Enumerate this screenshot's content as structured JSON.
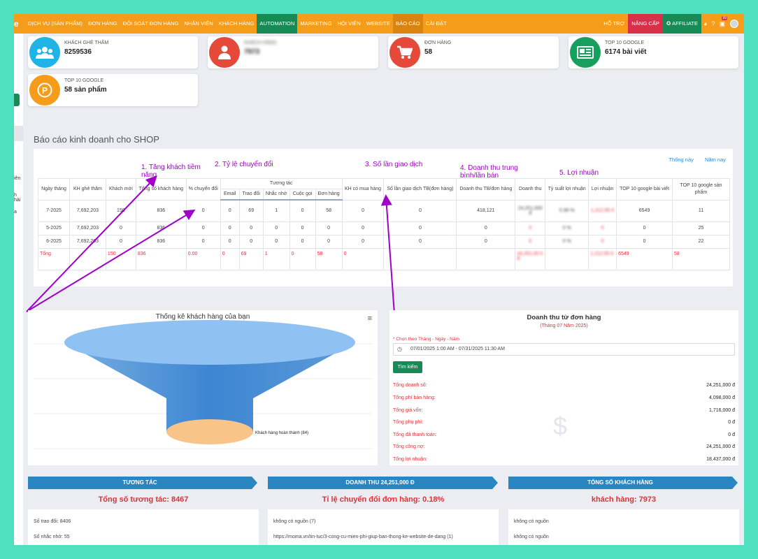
{
  "brand": "e",
  "nav": {
    "items": [
      "DỊCH VỤ (SẢN PHẨM)",
      "ĐƠN HÀNG",
      "ĐỐI SOÁT ĐƠN HÀNG",
      "NHÂN VIÊN",
      "KHÁCH HÀNG",
      "AUTOMATION",
      "MARKETING",
      "HỘI VIÊN",
      "WEBSITE",
      "BÁO CÁO",
      "CÀI ĐẶT"
    ],
    "support": "HỖ TRỢ",
    "upgrade": "NÂNG CẤP",
    "affiliate": "AFFILIATE",
    "notif_count": "99"
  },
  "sidebar": {
    "fragments": [
      "iên",
      "h hài",
      "a"
    ]
  },
  "stats": [
    {
      "label": "KHÁCH GHÉ THĂM",
      "value": "8259536",
      "color": "#1fb3e6",
      "icon": "users-icon"
    },
    {
      "label": "KHÁCH HÀNG",
      "value": "7973",
      "color": "#e5493a",
      "icon": "user-icon"
    },
    {
      "label": "ĐƠN HÀNG",
      "value": "58",
      "color": "#e5493a",
      "icon": "cart-icon"
    },
    {
      "label": "TOP 10 GOOGLE",
      "value": "6174 bài viết",
      "color": "#17a05d",
      "icon": "newspaper-icon"
    },
    {
      "label": "TOP 10 GOOGLE",
      "value": "58 sản phẩm",
      "color": "#f59c1a",
      "icon": "product-p-icon"
    }
  ],
  "report": {
    "title": "Báo cáo kinh doanh cho SHOP",
    "link_today": "Thống này",
    "link_year": "Năm nay",
    "group_header": "Tương tác",
    "headers": [
      "Ngày tháng",
      "KH ghé thăm",
      "Khách mới",
      "Tổng số khách hàng",
      "% chuyển đổi",
      "Email",
      "Trao đổi",
      "Nhắc nhở",
      "Cuộc gọi",
      "Đơn hàng",
      "KH có mua hàng",
      "Số lần giao dịch TB(đơn hàng)",
      "Doanh thu TB/đơn hàng",
      "Doanh thu",
      "Tỷ suất lợi nhuận",
      "Lợi nhuận",
      "TOP 10 google bài viết",
      "TOP 10 google sản phẩm"
    ],
    "rows": [
      [
        "7-2025",
        "7,692,203",
        "150",
        "836",
        "0",
        "0",
        "69",
        "1",
        "0",
        "58",
        "0",
        "0",
        "418,121",
        "24,251,000 đ",
        "5.98 %",
        "1,212,55 0",
        "6549",
        "11"
      ],
      [
        "5-2025",
        "7,692,203",
        "0",
        "836",
        "0",
        "0",
        "0",
        "0",
        "0",
        "0",
        "0",
        "0",
        "0",
        "0",
        "0 %",
        "0",
        "0",
        "25"
      ],
      [
        "6-2025",
        "7,692,203",
        "0",
        "836",
        "0",
        "0",
        "0",
        "0",
        "0",
        "0",
        "0",
        "0",
        "0",
        "0",
        "0 %",
        "0",
        "0",
        "22"
      ]
    ],
    "total": [
      "Tổng",
      "",
      "150",
      "836",
      "0.00",
      "0",
      "69",
      "1",
      "0",
      "58",
      "0",
      "",
      "",
      "24,251,00 0 đ",
      "",
      "1,212,55 0",
      "6549",
      "58"
    ]
  },
  "annotations": [
    "1. Tăng khách tiềm năng",
    "2. Tỷ lệ chuyển đổi",
    "3. Số lần giao dịch",
    "4. Doanh thu trung bình/lần bán",
    "5. Lợi nhuận"
  ],
  "funnel": {
    "title": "Thống kê khách hàng của bạn",
    "label": "Khách hàng hoàn thành (84)"
  },
  "revenue": {
    "title": "Doanh thu từ đơn hàng",
    "subtitle": "(Tháng 07 Năm 2025)",
    "filter_label": "* Chọn theo Tháng - Ngày - Năm",
    "date_range": "07/01/2025 1:00 AM - 07/31/2025 11:30 AM",
    "search_button": "Tìm kiếm",
    "rows": [
      {
        "k": "Tổng doanh số:",
        "v": "24,251,000 đ"
      },
      {
        "k": "Tổng phí bán hàng:",
        "v": "4,098,000 đ"
      },
      {
        "k": "Tổng giá vốn:",
        "v": "1,716,000 đ"
      },
      {
        "k": "Tổng phụ phí:",
        "v": "0 đ"
      },
      {
        "k": "Tổng đã thanh toán:",
        "v": "0 đ"
      },
      {
        "k": "Tổng công nợ:",
        "v": "24,251,000 đ"
      },
      {
        "k": "Tổng lợi nhuận:",
        "v": "18,437,000 đ"
      }
    ]
  },
  "panels": [
    {
      "head": "TƯƠNG TÁC",
      "big": "Tổng số tương tác: 8467",
      "lines": [
        "Số trao đổi: 8406",
        "Số nhắc nhở: 55"
      ]
    },
    {
      "head": "DOANH THU 24,251,000 Đ",
      "big": "Tỉ lệ chuyển đổi đơn hàng: 0.18%",
      "lines": [
        "không có nguồn (7)",
        "https://moma.vn/tin-tuc/3-cong-cu-mien-phi-giup-ban-thong-ke-website-de-dang (1)"
      ]
    },
    {
      "head": "TỔNG SỐ KHÁCH HÀNG",
      "big": "khách hàng: 7973",
      "lines": [
        "không có nguồn",
        "không có nguồn"
      ]
    }
  ]
}
